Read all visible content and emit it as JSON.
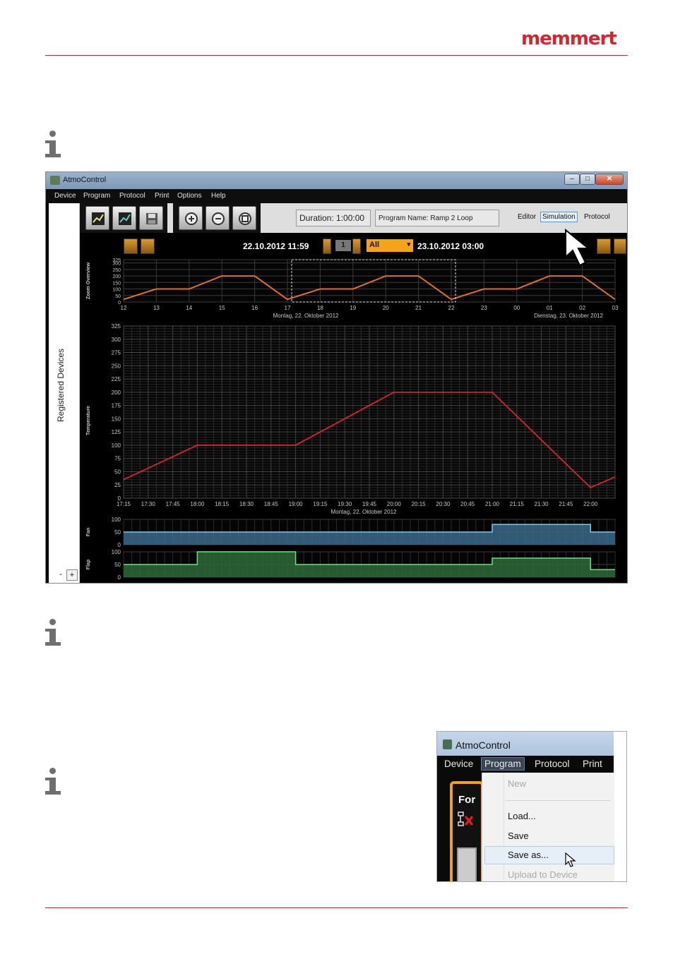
{
  "header": {
    "logo_text": "memmert",
    "accent_color": "#d4262e"
  },
  "main_window": {
    "title": "AtmoControl",
    "menu": [
      "Device",
      "Program",
      "Protocol",
      "Print",
      "Options",
      "Help"
    ],
    "side_label": "Registered Devices",
    "side_minus": "-",
    "side_plus": "+",
    "duration": "Duration:  1:00:00",
    "program_name": "Program Name:   Ramp 2 Loop",
    "modes": {
      "editor": "Editor",
      "simulation": "Simulation",
      "protocol": "Protocol"
    },
    "nav": {
      "start": "22.10.2012 11:59",
      "page": "1",
      "filter": "All",
      "end": "23.10.2012 03:00"
    }
  },
  "chart_data": [
    {
      "type": "line",
      "title": "Zoom Overview",
      "ylabel": "Zoom Overview",
      "x_ticks": [
        "12",
        "13",
        "14",
        "15",
        "16",
        "17",
        "18",
        "19",
        "20",
        "21",
        "22",
        "23",
        "00",
        "01",
        "02",
        "03"
      ],
      "y_ticks": [
        0,
        50,
        100,
        150,
        200,
        250,
        300,
        325
      ],
      "date_labels": [
        "Montag, 22. Oktober 2012",
        "Dienstag, 23. Oktober 2012"
      ],
      "ylim": [
        0,
        325
      ],
      "series": [
        {
          "x": [
            12,
            13,
            14,
            15,
            16,
            17,
            18,
            19,
            20,
            21,
            22,
            23,
            24,
            25,
            26,
            27
          ],
          "values": [
            20,
            100,
            100,
            200,
            200,
            20,
            100,
            100,
            200,
            200,
            20,
            100,
            100,
            200,
            200,
            20
          ]
        }
      ],
      "line_color": "#e0702a",
      "selection_range": [
        17,
        22
      ]
    },
    {
      "type": "line",
      "ylabel": "Temperature",
      "x_ticks": [
        "17:15",
        "17:30",
        "17:45",
        "18:00",
        "18:15",
        "18:30",
        "18:45",
        "19:00",
        "19:15",
        "19:30",
        "19:45",
        "20:00",
        "20:15",
        "20:30",
        "20:45",
        "21:00",
        "21:15",
        "21:30",
        "21:45",
        "22:00"
      ],
      "y_ticks": [
        0,
        25,
        50,
        75,
        100,
        125,
        150,
        175,
        200,
        225,
        250,
        275,
        300,
        325
      ],
      "date_label": "Montag, 22. Oktober 2012",
      "ylim": [
        0,
        325
      ],
      "series": [
        {
          "x": [
            "17:15",
            "18:00",
            "19:00",
            "20:00",
            "21:00",
            "22:00",
            "22:15"
          ],
          "values": [
            35,
            100,
            100,
            200,
            200,
            20,
            40
          ]
        }
      ],
      "line_color": "#d4262e"
    },
    {
      "type": "area",
      "ylabel": "Fan",
      "y_ticks": [
        0,
        50,
        100
      ],
      "ylim": [
        0,
        100
      ],
      "series": [
        {
          "x": [
            "17:15",
            "21:00",
            "21:00",
            "22:00",
            "22:00",
            "22:15"
          ],
          "values": [
            50,
            50,
            80,
            80,
            50,
            50
          ]
        }
      ],
      "fill_color": "#3c6a8a",
      "line_color": "#7fc8f0"
    },
    {
      "type": "area",
      "ylabel": "Flap",
      "y_ticks": [
        0,
        50,
        100
      ],
      "ylim": [
        0,
        100
      ],
      "series": [
        {
          "x": [
            "17:15",
            "18:00",
            "18:00",
            "19:00",
            "19:00",
            "21:00",
            "21:00",
            "22:00",
            "22:00",
            "22:15"
          ],
          "values": [
            50,
            50,
            100,
            100,
            50,
            50,
            75,
            75,
            30,
            30
          ]
        }
      ],
      "fill_color": "#2e6a3a",
      "line_color": "#6ee07a"
    }
  ],
  "menu_window": {
    "title": "AtmoControl",
    "menu": [
      "Device",
      "Program",
      "Protocol",
      "Print"
    ],
    "left_label": "For",
    "items": [
      {
        "label": "New",
        "enabled": false
      },
      {
        "label": "Load...",
        "enabled": true
      },
      {
        "label": "Save",
        "enabled": true
      },
      {
        "label": "Save as...",
        "enabled": true
      },
      {
        "label": "Upload to Device",
        "enabled": false
      }
    ]
  }
}
